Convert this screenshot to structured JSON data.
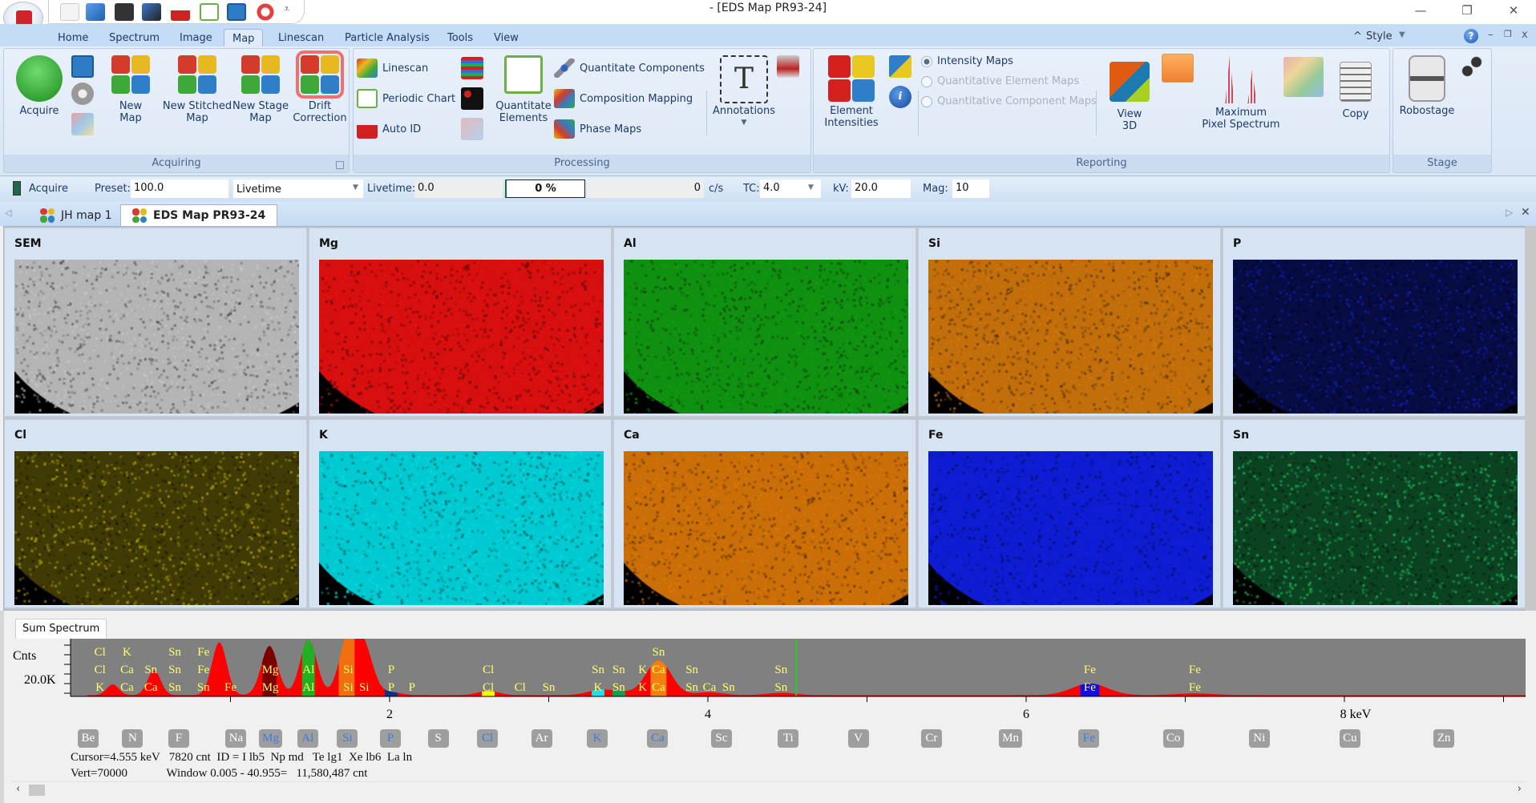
{
  "window": {
    "title": "- [EDS Map PR93-24]",
    "minimize": "—",
    "restore": "❐",
    "close": "✕"
  },
  "quick_access": {
    "icons": [
      "new-project-icon",
      "open-folder-icon",
      "save-icon",
      "save-all-icon",
      "spectrum-icon",
      "periodic-table-icon",
      "report-icon",
      "help-lifebuoy-icon"
    ],
    "customize": "⩡"
  },
  "ribbon_tabs": [
    {
      "label": "Home"
    },
    {
      "label": "Spectrum"
    },
    {
      "label": "Image"
    },
    {
      "label": "Map",
      "active": true
    },
    {
      "label": "Linescan"
    },
    {
      "label": "Particle Analysis"
    },
    {
      "label": "Tools"
    },
    {
      "label": "View"
    }
  ],
  "ribbon_right": {
    "style_label": "Style",
    "collapse": "^",
    "help": "?",
    "mdi_min": "–",
    "mdi_restore": "❐",
    "mdi_close": "x"
  },
  "groups": {
    "acquiring": {
      "label": "Acquiring",
      "buttons": {
        "acquire": "Acquire",
        "new_map": "New\nMap",
        "new_stitched_map": "New Stitched\nMap",
        "new_stage_map": "New Stage\nMap",
        "drift_correction": "Drift\nCorrection"
      }
    },
    "processing": {
      "label": "Processing",
      "buttons": {
        "linescan": "Linescan",
        "periodic_chart": "Periodic Chart",
        "auto_id": "Auto ID",
        "quantitate_elements": "Quantitate\nElements",
        "quantitate_components": "Quantitate Components",
        "composition_mapping": "Composition Mapping",
        "phase_maps": "Phase Maps",
        "annotations": "Annotations"
      }
    },
    "reporting": {
      "label": "Reporting",
      "buttons": {
        "element_intensities": "Element\nIntensities",
        "view_3d": "View\n3D",
        "max_pixel_spectrum": "Maximum\nPixel Spectrum",
        "copy": "Copy"
      },
      "radios": [
        {
          "label": "Intensity Maps",
          "selected": true,
          "enabled": true
        },
        {
          "label": "Quantitative Element Maps",
          "selected": false,
          "enabled": false
        },
        {
          "label": "Quantitative Component Maps",
          "selected": false,
          "enabled": false
        }
      ]
    },
    "stage": {
      "label": "Stage",
      "buttons": {
        "robostage": "Robostage"
      }
    }
  },
  "acquire_bar": {
    "acquire": "Acquire",
    "preset_label": "Preset:",
    "preset_value": "100.0",
    "mode": "Livetime",
    "livetime_label": "Livetime:",
    "livetime_value": "0.0",
    "progress_text": "0 %",
    "progress": 0,
    "rate_value": "0",
    "rate_unit": "c/s",
    "tc_label": "TC:",
    "tc_value": "4.0",
    "kv_label": "kV:",
    "kv_value": "20.0",
    "mag_label": "Mag:",
    "mag_value": "10"
  },
  "doc_tabs": [
    {
      "label": "JH map 1",
      "active": false
    },
    {
      "label": "EDS Map PR93-24",
      "active": true
    }
  ],
  "maps": [
    {
      "label": "SEM",
      "color": "#c8c8c8"
    },
    {
      "label": "Mg",
      "color": "#ee1111"
    },
    {
      "label": "Al",
      "color": "#12a012"
    },
    {
      "label": "Si",
      "color": "#d67a0c"
    },
    {
      "label": "P",
      "color": "#1522c0"
    },
    {
      "label": "Cl",
      "color": "#b7a80c"
    },
    {
      "label": "K",
      "color": "#00e0e8"
    },
    {
      "label": "Ca",
      "color": "#e07a08"
    },
    {
      "label": "Fe",
      "color": "#1020e8"
    },
    {
      "label": "Sn",
      "color": "#20c060"
    }
  ],
  "spectrum": {
    "tab_label": "Sum Spectrum",
    "y_label": "Cnts",
    "y_tick_label": "20.0K",
    "x_tick_labels": [
      {
        "v": 2,
        "t": "2"
      },
      {
        "v": 4,
        "t": "4"
      },
      {
        "v": 6,
        "t": "6"
      },
      {
        "v": 8,
        "t": "8 keV"
      }
    ],
    "cursor_keV": 4.555,
    "peak_labels": [
      {
        "e": 0.18,
        "lines": [
          "K",
          "Cl",
          "Cl"
        ]
      },
      {
        "e": 0.35,
        "lines": [
          "Ca",
          "Ca",
          "K"
        ]
      },
      {
        "e": 0.5,
        "lines": [
          "Ca",
          "Sn"
        ]
      },
      {
        "e": 0.65,
        "lines": [
          "Sn",
          "Sn",
          "Sn"
        ]
      },
      {
        "e": 0.83,
        "lines": [
          "Sn",
          "Fe",
          "Fe"
        ]
      },
      {
        "e": 1.0,
        "lines": [
          "Fe"
        ]
      },
      {
        "e": 1.25,
        "lines": [
          "Mg",
          "Mg"
        ]
      },
      {
        "e": 1.49,
        "lines": [
          "Al",
          "Al"
        ]
      },
      {
        "e": 1.74,
        "lines": [
          "Si",
          "Si"
        ]
      },
      {
        "e": 1.84,
        "lines": [
          "Si"
        ]
      },
      {
        "e": 2.01,
        "lines": [
          "P",
          "P"
        ]
      },
      {
        "e": 2.14,
        "lines": [
          "P"
        ]
      },
      {
        "e": 2.62,
        "lines": [
          "Cl",
          "Cl"
        ]
      },
      {
        "e": 2.82,
        "lines": [
          "Cl"
        ]
      },
      {
        "e": 3.0,
        "lines": [
          "Sn"
        ]
      },
      {
        "e": 3.31,
        "lines": [
          "K",
          "Sn"
        ]
      },
      {
        "e": 3.44,
        "lines": [
          "Sn",
          "Sn"
        ]
      },
      {
        "e": 3.59,
        "lines": [
          "K",
          "K"
        ]
      },
      {
        "e": 3.69,
        "lines": [
          "Ca",
          "Ca",
          "Sn"
        ]
      },
      {
        "e": 3.9,
        "lines": [
          "Sn",
          "Sn"
        ]
      },
      {
        "e": 4.01,
        "lines": [
          "Ca"
        ]
      },
      {
        "e": 4.13,
        "lines": [
          "Sn"
        ]
      },
      {
        "e": 4.46,
        "lines": [
          "Sn",
          "Sn"
        ]
      },
      {
        "e": 6.4,
        "lines": [
          "Fe",
          "Fe"
        ]
      },
      {
        "e": 7.06,
        "lines": [
          "Fe",
          "Fe"
        ]
      }
    ],
    "elements": [
      {
        "sym": "Be",
        "e": 0.11
      },
      {
        "sym": "N",
        "e": 0.39
      },
      {
        "sym": "F",
        "e": 0.68
      },
      {
        "sym": "Na",
        "e": 1.04
      },
      {
        "sym": "Mg",
        "e": 1.25,
        "on": true
      },
      {
        "sym": "Al",
        "e": 1.49,
        "on": true
      },
      {
        "sym": "Si",
        "e": 1.74,
        "on": true
      },
      {
        "sym": "P",
        "e": 2.01,
        "on": true
      },
      {
        "sym": "S",
        "e": 2.31
      },
      {
        "sym": "Cl",
        "e": 2.62,
        "on": true
      },
      {
        "sym": "Ar",
        "e": 2.96
      },
      {
        "sym": "K",
        "e": 3.31,
        "on": true
      },
      {
        "sym": "Ca",
        "e": 3.69,
        "on": true
      },
      {
        "sym": "Sc",
        "e": 4.09
      },
      {
        "sym": "Ti",
        "e": 4.51
      },
      {
        "sym": "V",
        "e": 4.95
      },
      {
        "sym": "Cr",
        "e": 5.41
      },
      {
        "sym": "Mn",
        "e": 5.9
      },
      {
        "sym": "Fe",
        "e": 6.4,
        "on": true
      },
      {
        "sym": "Co",
        "e": 6.93
      },
      {
        "sym": "Ni",
        "e": 7.47
      },
      {
        "sym": "Cu",
        "e": 8.04
      },
      {
        "sym": "Zn",
        "e": 8.63
      }
    ],
    "status_line1": "Cursor=4.555 keV   7820 cnt  ID = I lb5  Np md   Te lg1  Xe lb6  La ln",
    "status_line2": "Vert=70000             Window 0.005 - 40.955=   11,580,487 cnt"
  },
  "chart_data": {
    "type": "area",
    "title": "Sum Spectrum",
    "xlabel": "keV",
    "ylabel": "Cnts",
    "xlim": [
      0,
      9.5
    ],
    "ylim": [
      0,
      70000
    ],
    "x_ticks": [
      2,
      4,
      6,
      8
    ],
    "peaks": [
      {
        "e": 0.26,
        "counts": 13000
      },
      {
        "e": 0.52,
        "counts": 30000
      },
      {
        "e": 0.93,
        "counts": 64000
      },
      {
        "e": 1.22,
        "counts": 11000
      },
      {
        "e": 1.25,
        "counts": 50000
      },
      {
        "e": 1.49,
        "counts": 67000
      },
      {
        "e": 1.74,
        "counts": 70000
      },
      {
        "e": 1.84,
        "counts": 55000
      },
      {
        "e": 2.01,
        "counts": 3500
      },
      {
        "e": 2.62,
        "counts": 5000
      },
      {
        "e": 3.31,
        "counts": 5500
      },
      {
        "e": 3.44,
        "counts": 4000
      },
      {
        "e": 3.69,
        "counts": 42000
      },
      {
        "e": 4.01,
        "counts": 3500
      },
      {
        "e": 4.46,
        "counts": 2800
      },
      {
        "e": 6.4,
        "counts": 14000
      },
      {
        "e": 7.06,
        "counts": 2000
      }
    ],
    "background_counts": 1600,
    "highlight_windows": [
      {
        "element": "Mg",
        "from": 1.2,
        "to": 1.29,
        "color": "#7a0000"
      },
      {
        "element": "Al",
        "from": 1.45,
        "to": 1.53,
        "color": "#22b022"
      },
      {
        "element": "Si",
        "from": 1.68,
        "to": 1.78,
        "color": "#f07010"
      },
      {
        "element": "P",
        "from": 1.97,
        "to": 2.05,
        "color": "#10308a"
      },
      {
        "element": "Cl",
        "from": 2.58,
        "to": 2.66,
        "color": "#ffff00"
      },
      {
        "element": "K",
        "from": 3.27,
        "to": 3.35,
        "color": "#20e0e8"
      },
      {
        "element": "Ca",
        "from": 3.64,
        "to": 3.74,
        "color": "#f08010"
      },
      {
        "element": "Fe",
        "from": 6.34,
        "to": 6.46,
        "color": "#1010e0"
      },
      {
        "element": "Sn",
        "from": 3.4,
        "to": 3.48,
        "color": "#10a050"
      }
    ],
    "cursor_keV": 4.555
  }
}
